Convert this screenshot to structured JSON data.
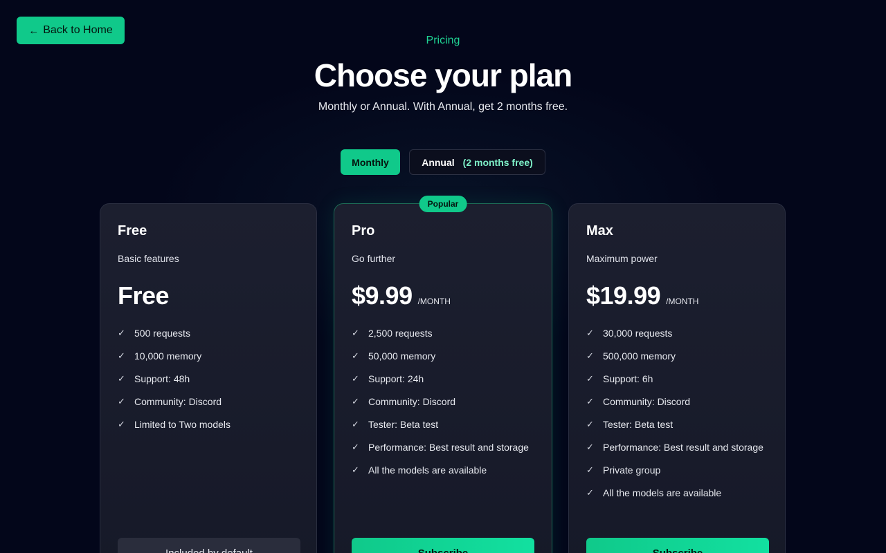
{
  "nav": {
    "back_label": "Back to Home"
  },
  "header": {
    "eyebrow": "Pricing",
    "title": "Choose your plan",
    "subtitle": "Monthly or Annual. With Annual, get 2 months free."
  },
  "billing_toggle": {
    "monthly_label": "Monthly",
    "annual_label": "Annual",
    "annual_tag": "(2 months free)",
    "selected": "Monthly"
  },
  "colors": {
    "accent": "#10c98a",
    "background": "#03061a",
    "card": "#1c1f2f"
  },
  "plans": [
    {
      "name": "Free",
      "description": "Basic features",
      "price": "Free",
      "unit": "",
      "features": [
        "500 requests",
        "10,000 memory",
        "Support: 48h",
        "Community: Discord",
        "Limited to Two models"
      ],
      "cta": "Included by default"
    },
    {
      "name": "Pro",
      "badge": "Popular",
      "description": "Go further",
      "price": "$9.99",
      "unit": "/MONTH",
      "features": [
        "2,500 requests",
        "50,000 memory",
        "Support: 24h",
        "Community: Discord",
        "Tester: Beta test",
        "Performance: Best result and storage",
        "All the models are available"
      ],
      "cta": "Subscribe"
    },
    {
      "name": "Max",
      "description": "Maximum power",
      "price": "$19.99",
      "unit": "/MONTH",
      "features": [
        "30,000 requests",
        "500,000 memory",
        "Support: 6h",
        "Community: Discord",
        "Tester: Beta test",
        "Performance: Best result and storage",
        "Private group",
        "All the models are available"
      ],
      "cta": "Subscribe"
    }
  ]
}
